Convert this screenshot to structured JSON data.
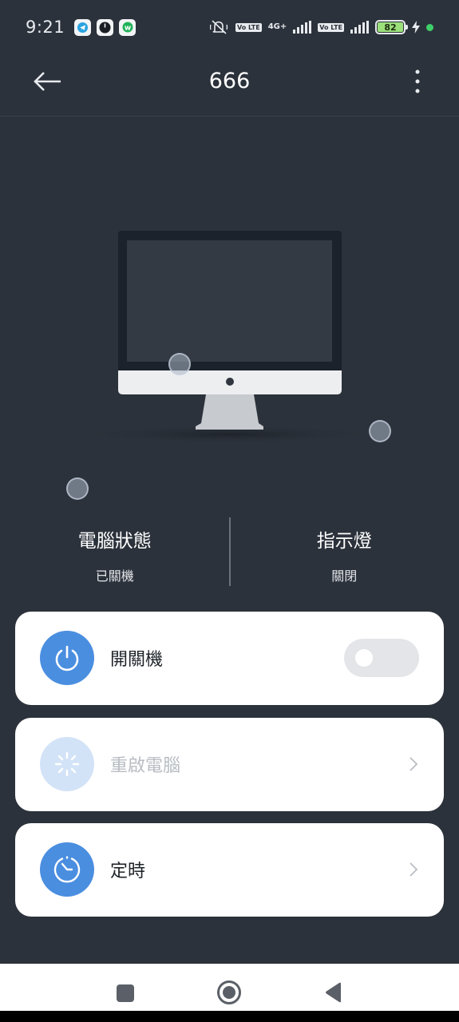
{
  "status_bar": {
    "time": "9:21",
    "battery": "82",
    "network": "4G+",
    "volte": "Vo LTE",
    "app_icons": [
      "telegram-icon",
      "clock-app-icon",
      "wechat-icon"
    ]
  },
  "header": {
    "title": "666"
  },
  "status_info": {
    "computer_status_title": "電腦狀態",
    "computer_status_value": "已關機",
    "indicator_title": "指示燈",
    "indicator_value": "關閉"
  },
  "controls": {
    "power": {
      "label": "開關機",
      "toggle_on": false,
      "icon": "power-icon"
    },
    "restart": {
      "label": "重啟電腦",
      "enabled": false,
      "icon": "loading-spinner-icon"
    },
    "timer": {
      "label": "定時",
      "icon": "timer-icon"
    }
  },
  "colors": {
    "background": "#2c323b",
    "accent": "#4a8ee0",
    "accent_disabled": "#d3e3f7",
    "card": "#ffffff",
    "battery": "#9be07a"
  }
}
